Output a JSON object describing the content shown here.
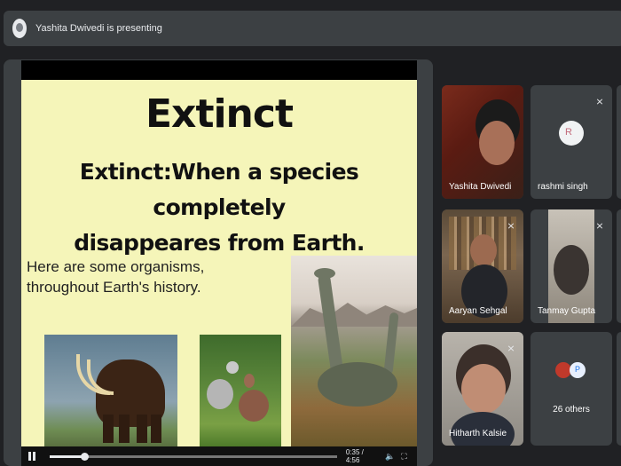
{
  "presenter": {
    "text": "Yashita Dwivedi is presenting"
  },
  "slide": {
    "title": "Extinct",
    "definition_line1": "Extinct:When a species completely",
    "definition_line2": "disappeares from Earth.",
    "subtitle_line1": "Here are some organisms,",
    "subtitle_line2": "throughout Earth's history."
  },
  "video": {
    "time": "0:35 / 4:56",
    "progress": 0.12
  },
  "participants": [
    {
      "name": "Yashita Dwivedi",
      "muted": false
    },
    {
      "name": "rashmi singh",
      "muted": true
    },
    {
      "name": "Aaryan Sehgal",
      "muted": true
    },
    {
      "name": "Tanmay Gupta",
      "muted": true
    },
    {
      "name": "Hitharth Kalsie",
      "muted": true
    }
  ],
  "others": {
    "label": "26 others"
  },
  "colors": {
    "background": "#202124",
    "tile": "#3c4043",
    "slide_bg": "#f5f5b9"
  }
}
